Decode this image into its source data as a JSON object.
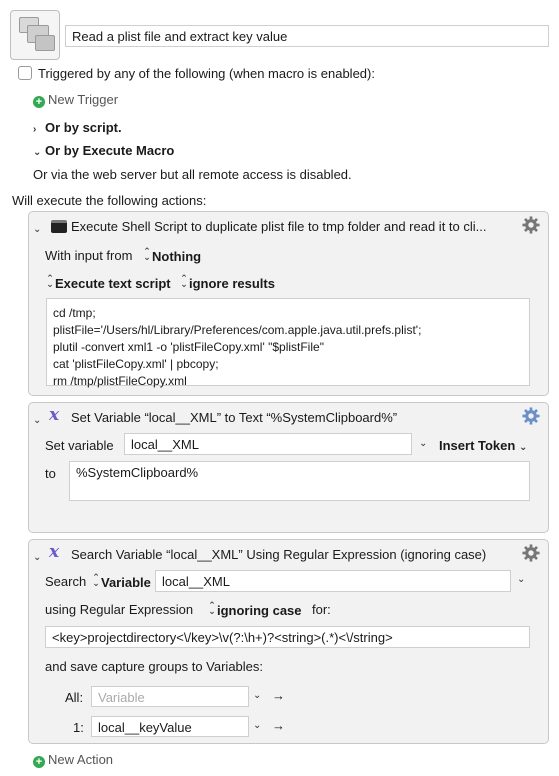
{
  "macro": {
    "name": "Read a plist file and extract key value"
  },
  "triggers": {
    "checkbox_label": "Triggered by any of the following (when macro is enabled):",
    "new_trigger": "New Trigger",
    "or_by_script": "Or by script.",
    "or_by_execute_macro": "Or by Execute Macro",
    "web_server_note": "Or via the web server but all remote access is disabled."
  },
  "actions_header": "Will execute the following actions:",
  "action1": {
    "title": "Execute Shell Script to duplicate plist file to tmp folder and read it to cli...",
    "with_input_label": "With input from",
    "with_input_value": "Nothing",
    "execute_mode": "Execute text script",
    "results_mode": "ignore results",
    "script_lines": [
      "cd /tmp;",
      "plistFile='/Users/hl/Library/Preferences/com.apple.java.util.prefs.plist';",
      "plutil -convert xml1 -o 'plistFileCopy.xml' \"$plistFile\"",
      "cat 'plistFileCopy.xml' | pbcopy;",
      "rm /tmp/plistFileCopy.xml"
    ]
  },
  "action2": {
    "title": "Set Variable “local__XML” to Text “%SystemClipboard%”",
    "set_variable_label": "Set variable",
    "variable_value": "local__XML",
    "insert_token": "Insert Token",
    "to_label": "to",
    "to_value": "%SystemClipboard%"
  },
  "action3": {
    "title": "Search Variable “local__XML” Using Regular Expression (ignoring case)",
    "search_label": "Search",
    "search_type": "Variable",
    "variable_value": "local__XML",
    "using_label": "using Regular Expression",
    "case_mode": "ignoring case",
    "for_label": "for:",
    "regex": "<key>projectdirectory<\\/key>\\v(?:\\h+)?<string>(.*)<\\/string>",
    "save_label": "and save capture groups to Variables:",
    "all_label": "All:",
    "all_placeholder": "Variable",
    "group1_label": "1:",
    "group1_value": "local__keyValue"
  },
  "new_action": "New Action",
  "colors": {
    "action_bg": "#f2f2f2",
    "add_green": "#34a853",
    "variable_icon": "#6a5acd"
  }
}
